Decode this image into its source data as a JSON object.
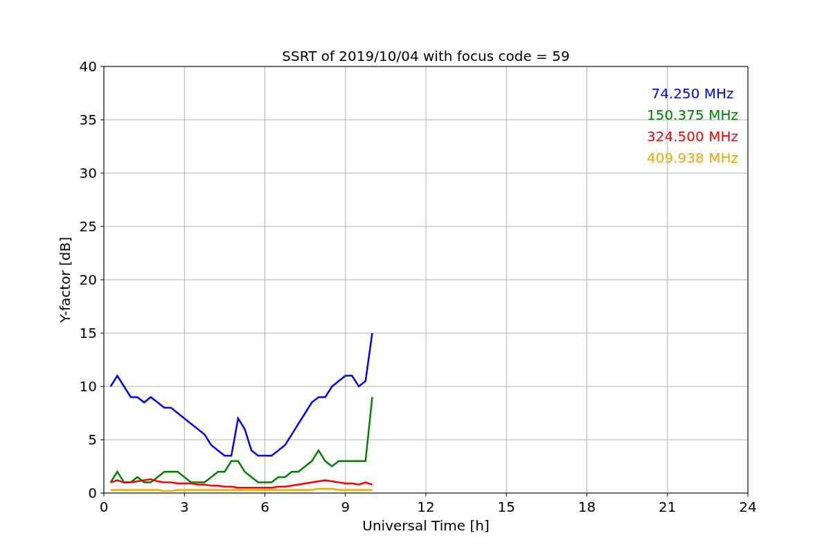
{
  "chart_data": {
    "type": "line",
    "title": "SSRT of 2019/10/04 with focus code = 59",
    "xlabel": "Universal Time [h]",
    "ylabel": "Y-factor [dB]",
    "x": [
      0.25,
      0.5,
      0.75,
      1,
      1.25,
      1.5,
      1.75,
      2,
      2.25,
      2.5,
      2.75,
      3,
      3.25,
      3.5,
      3.75,
      4,
      4.25,
      4.5,
      4.75,
      5,
      5.25,
      5.5,
      5.75,
      6,
      6.25,
      6.5,
      6.75,
      7,
      7.25,
      7.5,
      7.75,
      8,
      8.25,
      8.5,
      8.75,
      9,
      9.25,
      9.5,
      9.75,
      10
    ],
    "series": [
      {
        "name": "74.250 MHz",
        "color": "#0000ff",
        "values": [
          10,
          11,
          10,
          9,
          9,
          8.5,
          9,
          8.5,
          8,
          8,
          7.5,
          7,
          6.5,
          6,
          5.5,
          4.5,
          4,
          3.5,
          3.5,
          7,
          6,
          4,
          3.5,
          3.5,
          3.5,
          4,
          4.5,
          5.5,
          6.5,
          7.5,
          8.5,
          9,
          9,
          10,
          10.5,
          11,
          11,
          10,
          10.5,
          15
        ]
      },
      {
        "name": "150.375 MHz",
        "color": "#008000",
        "values": [
          1,
          2,
          1,
          1,
          1.5,
          1,
          1,
          1.5,
          2,
          2,
          2,
          1.5,
          1,
          1,
          1,
          1.5,
          2,
          2,
          3,
          3,
          2,
          1.5,
          1,
          1,
          1,
          1.5,
          1.5,
          2,
          2,
          2.5,
          3,
          4,
          3,
          2.5,
          3,
          3,
          3,
          3,
          3,
          9
        ]
      },
      {
        "name": "324.500 MHz",
        "color": "#ff0000",
        "values": [
          1,
          1.2,
          1,
          1,
          1.1,
          1.2,
          1.3,
          1.1,
          1,
          1,
          0.9,
          0.9,
          0.9,
          0.8,
          0.8,
          0.7,
          0.7,
          0.6,
          0.6,
          0.5,
          0.5,
          0.5,
          0.5,
          0.5,
          0.5,
          0.6,
          0.6,
          0.7,
          0.8,
          0.9,
          1,
          1.1,
          1.2,
          1.1,
          1,
          0.9,
          0.9,
          0.8,
          1,
          0.8
        ]
      },
      {
        "name": "409.938 MHz",
        "color": "#ffa500",
        "values": [
          0.3,
          0.3,
          0.3,
          0.3,
          0.3,
          0.3,
          0.3,
          0.3,
          0.2,
          0.2,
          0.3,
          0.3,
          0.3,
          0.3,
          0.3,
          0.3,
          0.3,
          0.3,
          0.3,
          0.3,
          0.3,
          0.3,
          0.3,
          0.3,
          0.3,
          0.3,
          0.3,
          0.3,
          0.3,
          0.3,
          0.3,
          0.4,
          0.4,
          0.4,
          0.3,
          0.3,
          0.3,
          0.3,
          0.3,
          0.3
        ]
      }
    ],
    "grid": true,
    "xlim": [
      0,
      24
    ],
    "ylim": [
      0,
      40
    ],
    "xticks": [
      0,
      3,
      6,
      9,
      12,
      15,
      18,
      21,
      24
    ],
    "yticks": [
      0,
      5,
      10,
      15,
      20,
      25,
      30,
      35,
      40
    ]
  }
}
